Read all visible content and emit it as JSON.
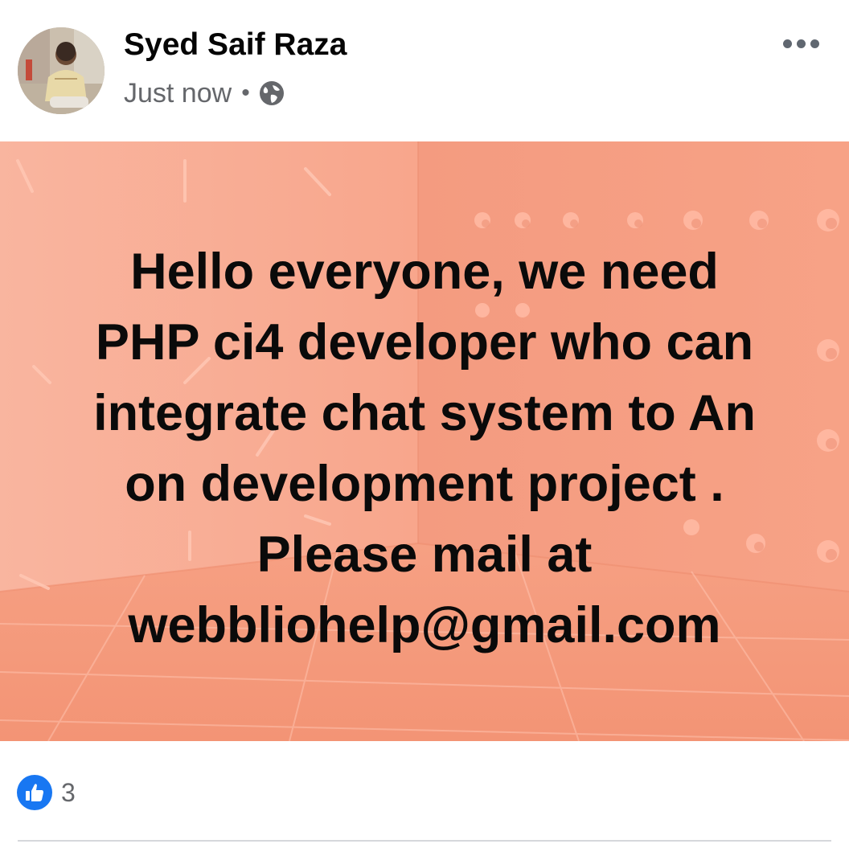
{
  "post": {
    "author": "Syed Saif Raza",
    "timestamp": "Just now",
    "separator": "•",
    "audience_icon": "globe-icon",
    "more_icon": "more-options-icon",
    "text_lines": [
      "Hello everyone, we need",
      "PHP ci4 developer who can",
      "integrate chat system to An",
      "on development project .",
      "Please mail at",
      "webbliohelp@gmail.com"
    ],
    "background_color": "#f7a48a"
  },
  "reactions": {
    "icon": "like-icon",
    "count": "3"
  },
  "colors": {
    "brand_blue": "#1877f2",
    "secondary_text": "#65676b"
  }
}
